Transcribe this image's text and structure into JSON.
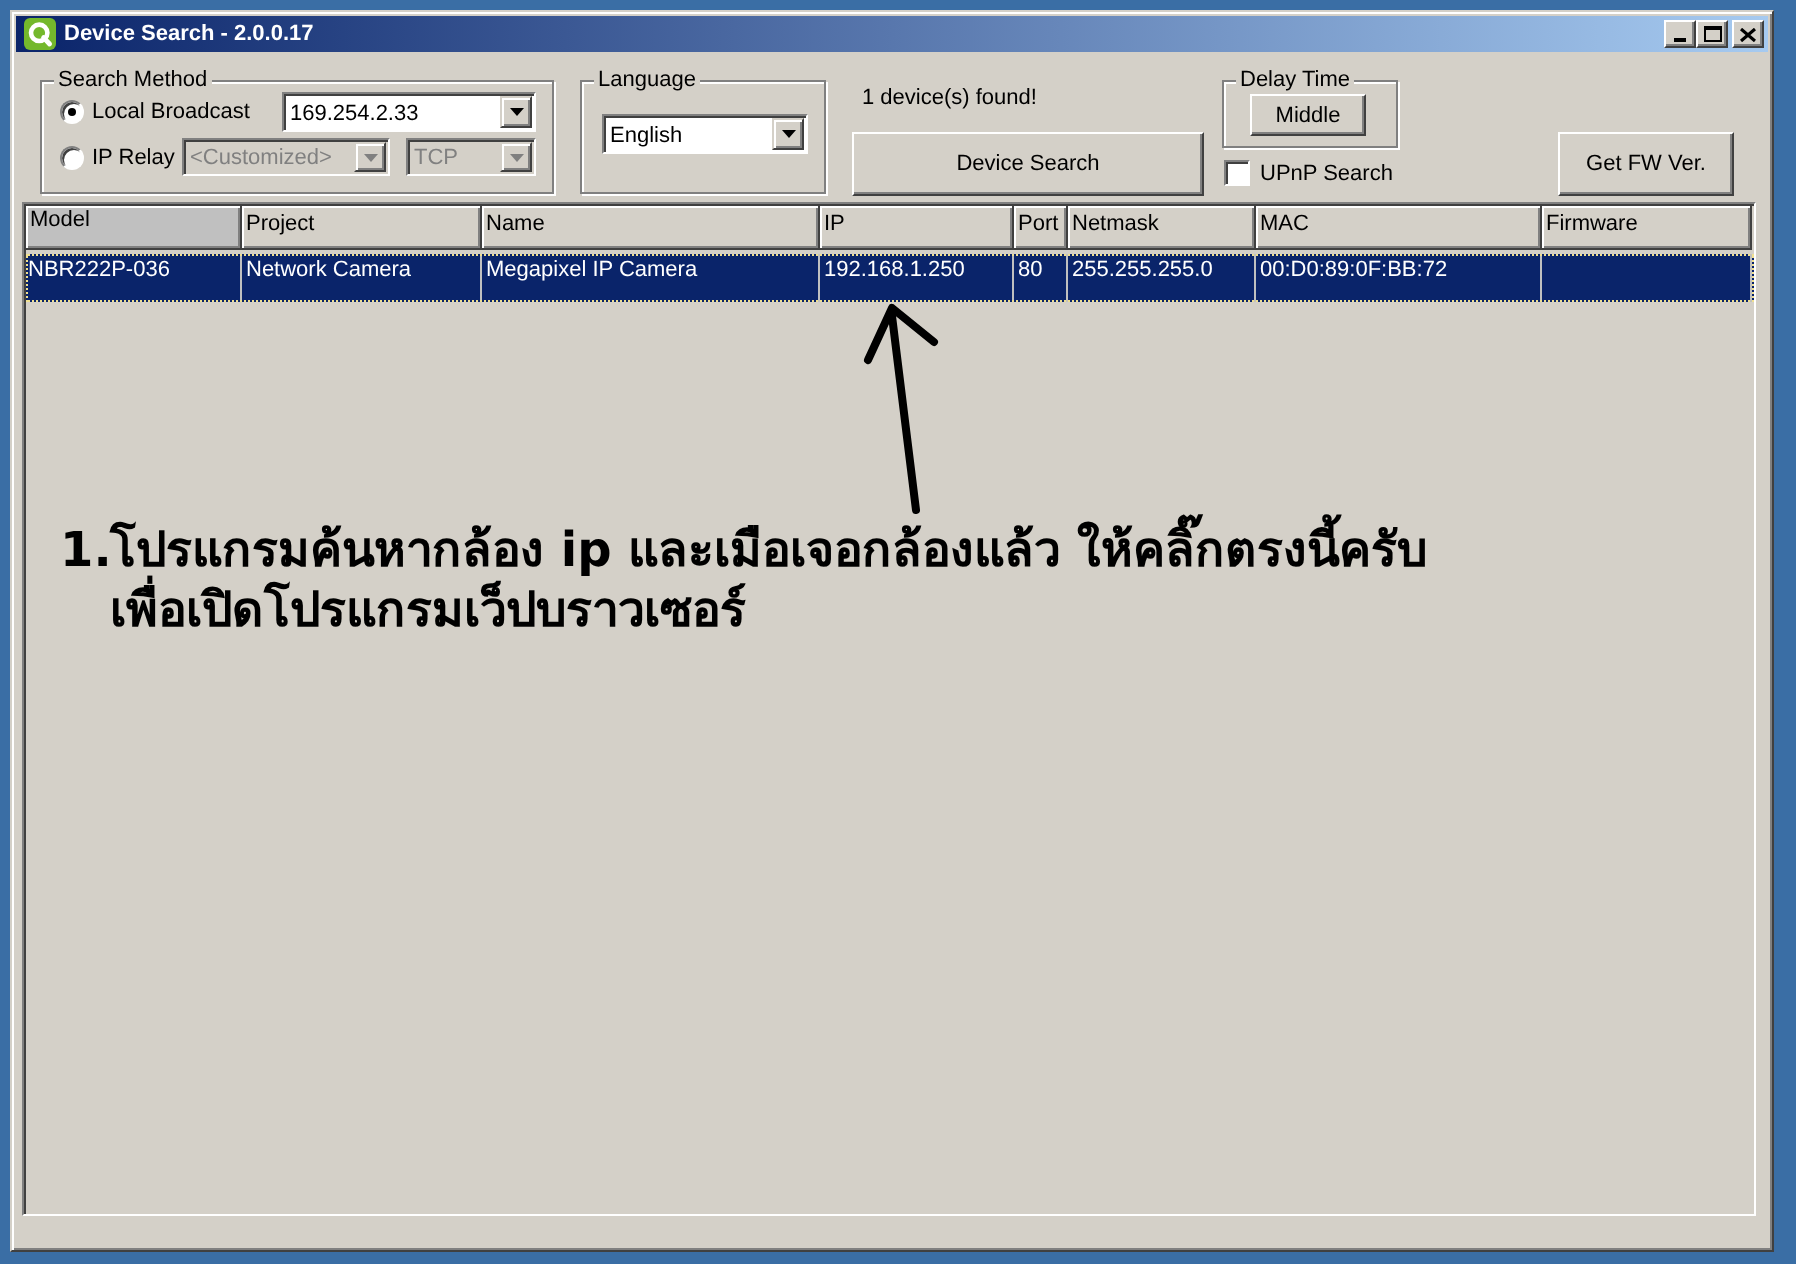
{
  "window": {
    "title": "Device Search - 2.0.0.17"
  },
  "search_method": {
    "label": "Search Method",
    "options": [
      {
        "label": "Local Broadcast",
        "selected": true,
        "fields": [
          {
            "value": "169.254.2.33",
            "disabled": false
          }
        ]
      },
      {
        "label": "IP Relay",
        "selected": false,
        "fields": [
          {
            "value": "<Customized>",
            "disabled": true
          },
          {
            "value": "TCP",
            "disabled": true
          }
        ]
      }
    ]
  },
  "language": {
    "label": "Language",
    "value": "English"
  },
  "status": "1 device(s) found!",
  "device_search_button": "Device Search",
  "delay_time": {
    "label": "Delay Time",
    "button": "Middle"
  },
  "upnp_search": {
    "label": "UPnP Search",
    "checked": false
  },
  "get_fw_button": "Get FW Ver.",
  "table": {
    "columns": [
      {
        "label": "Model",
        "sorted": true
      },
      {
        "label": "Project",
        "sorted": false
      },
      {
        "label": "Name",
        "sorted": false
      },
      {
        "label": "IP",
        "sorted": false
      },
      {
        "label": "Port",
        "sorted": false
      },
      {
        "label": "Netmask",
        "sorted": false
      },
      {
        "label": "MAC",
        "sorted": false
      },
      {
        "label": "Firmware",
        "sorted": false
      }
    ],
    "rows": [
      {
        "selected": true,
        "cells": [
          "NBR222P-036",
          "Network Camera",
          "Megapixel IP Camera",
          "192.168.1.250",
          "80",
          "255.255.255.0",
          "00:D0:89:0F:BB:72"
        ]
      }
    ]
  },
  "annotation": {
    "number": "1.",
    "text": "โปรแกรมค้นหากล้อง ip และเมือเจอกล้องแล้ว ให้คลิ๊กตรงนี้ครับ\nเพื่อเปิดโปรแกรมเว็ปบราวเซอร์"
  }
}
